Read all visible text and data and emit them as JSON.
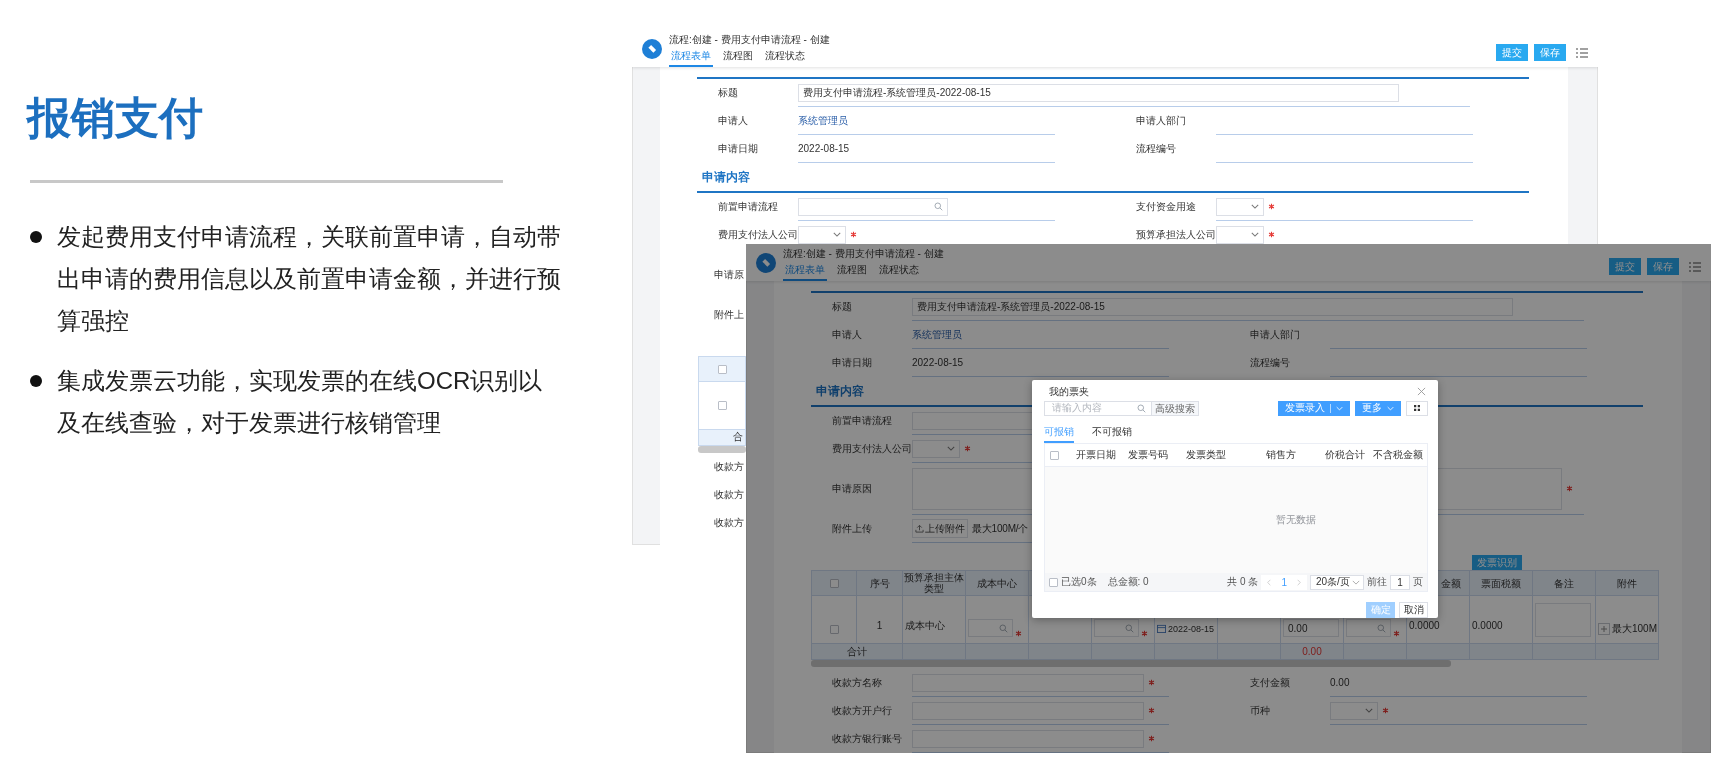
{
  "slide": {
    "title": "报销支付",
    "bullets": [
      "发起费用支付申请流程，关联前置申请，自动带出申请的费用信息以及前置申请金额，并进行预算强控",
      "集成发票云功能，实现发票的在线OCR识别以及在线查验，对于发票进行核销管理"
    ]
  },
  "back_window": {
    "title": "流程:创建 - 费用支付申请流程 - 创建",
    "tabs": [
      {
        "label": "流程表单",
        "selected": true
      },
      {
        "label": "流程图",
        "selected": false
      },
      {
        "label": "流程状态",
        "selected": false
      }
    ],
    "buttons": [
      "提交",
      "保存"
    ],
    "sections": [
      {
        "rows": [
          [
            {
              "label": "标题",
              "kind": "title",
              "value": "费用支付申请流程-系统管理员-2022-08-15"
            }
          ],
          [
            {
              "label": "申请人",
              "kind": "user",
              "value": "系统管理员"
            },
            {
              "label": "申请人部门",
              "kind": "text"
            }
          ],
          [
            {
              "label": "申请日期",
              "kind": "text",
              "value": "2022-08-15"
            },
            {
              "label": "流程编号",
              "kind": "text"
            }
          ]
        ]
      },
      {
        "title": "申请内容",
        "rows": [
          [
            {
              "label": "前置申请流程",
              "kind": "search"
            },
            {
              "label": "支付资金用途",
              "kind": "select",
              "required": true
            }
          ],
          [
            {
              "label": "费用支付法人公司",
              "kind": "select",
              "required": true
            },
            {
              "label": "预算承担法人公司",
              "kind": "select",
              "required": true
            }
          ]
        ]
      }
    ],
    "strip": {
      "labels_top": [
        "申请原",
        "附件上"
      ],
      "table": {
        "header_checked": false,
        "row_checked": false,
        "footer": "合"
      },
      "labels_bottom": [
        "收款方",
        "收款方",
        "收款方"
      ]
    }
  },
  "front_window": {
    "title": "流程:创建 - 费用支付申请流程 - 创建",
    "tabs": [
      {
        "label": "流程表单",
        "selected": true
      },
      {
        "label": "流程图",
        "selected": false
      },
      {
        "label": "流程状态",
        "selected": false
      }
    ],
    "buttons": [
      "提交",
      "保存"
    ],
    "sections": [
      {
        "rows": [
          [
            {
              "label": "标题",
              "kind": "title",
              "value": "费用支付申请流程-系统管理员-2022-08-15"
            }
          ],
          [
            {
              "label": "申请人",
              "kind": "user",
              "value": "系统管理员"
            },
            {
              "label": "申请人部门",
              "kind": "text"
            }
          ],
          [
            {
              "label": "申请日期",
              "kind": "text",
              "value": "2022-08-15"
            },
            {
              "label": "流程编号",
              "kind": "text"
            }
          ]
        ]
      },
      {
        "title": "申请内容",
        "rows": [
          [
            {
              "label": "前置申请流程",
              "kind": "search"
            }
          ],
          [
            {
              "label": "费用支付法人公司",
              "kind": "select",
              "required": true
            }
          ],
          [
            {
              "label": "申请原因",
              "kind": "textarea",
              "required": true
            }
          ],
          [
            {
              "label": "附件上传",
              "kind": "upload",
              "button_label": "上传附件",
              "value": "最大100M/个"
            }
          ]
        ]
      }
    ],
    "table": {
      "action_button": "发票识别",
      "columns": [
        {
          "kind": "checkbox",
          "checked": false
        },
        {
          "label": "序号"
        },
        {
          "label": "预算承担主体类型"
        },
        {
          "label": "成本中心"
        },
        {},
        {},
        {},
        {},
        {},
        {},
        {
          "label": "金额"
        },
        {
          "label": "票面税额"
        },
        {
          "label": "备注"
        },
        {
          "label": "附件"
        }
      ],
      "rows": [
        {
          "cells": [
            {
              "kind": "checkbox",
              "checked": false
            },
            {
              "kind": "text",
              "value": "1"
            },
            {
              "kind": "text",
              "value": "成本中心"
            },
            {
              "kind": "search",
              "required": true
            },
            {
              "kind": "empty"
            },
            {
              "kind": "search",
              "required": true
            },
            {
              "kind": "date",
              "value": "2022-08-15"
            },
            {
              "kind": "empty"
            },
            {
              "kind": "input",
              "value": "0.00"
            },
            {
              "kind": "search",
              "required": true
            },
            {
              "kind": "text",
              "value": "0.0000"
            },
            {
              "kind": "text",
              "value": "0.0000"
            },
            {
              "kind": "textarea"
            },
            {
              "kind": "attach",
              "value": "最大100M"
            }
          ]
        }
      ],
      "footer": {
        "label": "合计",
        "total": "0.00"
      }
    },
    "bottom_rows": [
      [
        {
          "label": "收款方名称",
          "kind": "input",
          "required": true
        },
        {
          "label": "支付金额",
          "kind": "text",
          "value": "0.00"
        }
      ],
      [
        {
          "label": "收款方开户行",
          "kind": "input",
          "required": true
        },
        {
          "label": "币种",
          "kind": "select",
          "required": true
        }
      ],
      [
        {
          "label": "收款方银行账号",
          "kind": "input",
          "required": true
        }
      ]
    ],
    "dialog": {
      "title": "我的票夹",
      "search": {
        "placeholder": "请输入内容"
      },
      "advanced_search": "高级搜索",
      "primary_split": "发票录入",
      "more": "更多",
      "tabs": [
        {
          "label": "可报销",
          "selected": true
        },
        {
          "label": "不可报销",
          "selected": false
        }
      ],
      "header_checked": false,
      "columns": [
        "开票日期",
        "发票号码",
        "发票类型",
        "销售方",
        "价税合计",
        "不含税金额"
      ],
      "empty_text": "暂无数据",
      "footer": {
        "select_all_checked": false,
        "selected_count": "已选0条",
        "total": "总金额: 0",
        "count": "共 0 条",
        "page": "1",
        "page_size": "20条/页",
        "goto_label": "前往",
        "goto_value": "1",
        "page_unit": "页"
      },
      "confirm": {
        "label": "确定",
        "disabled": true
      },
      "cancel": "取消"
    }
  }
}
